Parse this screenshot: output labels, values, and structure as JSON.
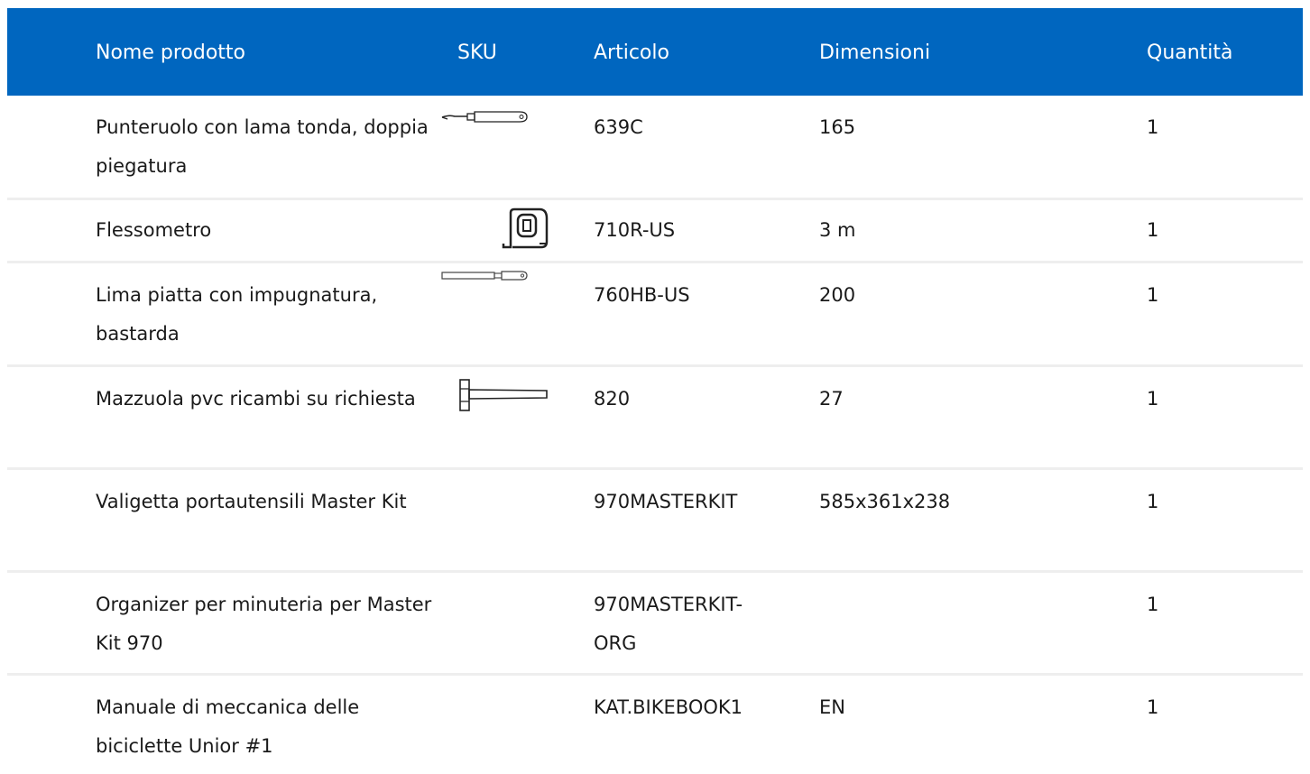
{
  "header": {
    "name": "Nome prodotto",
    "sku": "SKU",
    "article": "Articolo",
    "dimensions": "Dimensioni",
    "quantity": "Quantità"
  },
  "rows": [
    {
      "name": "Punteruolo con lama tonda, doppia piegatura",
      "article": "639C",
      "dimensions": "165",
      "quantity": "1",
      "icon": "awl-icon"
    },
    {
      "name": "Flessometro",
      "article": "710R-US",
      "dimensions": "3 m",
      "quantity": "1",
      "icon": "tape-measure-icon"
    },
    {
      "name": "Lima piatta con impugnatura, bastarda",
      "article": "760HB-US",
      "dimensions": "200",
      "quantity": "1",
      "icon": "file-tool-icon"
    },
    {
      "name": "Mazzuola pvc ricambi su richiesta",
      "article": "820",
      "dimensions": "27",
      "quantity": "1",
      "icon": "mallet-icon"
    },
    {
      "name": "Valigetta portautensili Master Kit",
      "article": "970MASTERKIT",
      "dimensions": "585x361x238",
      "quantity": "1",
      "icon": ""
    },
    {
      "name": "Organizer per minuteria per Master Kit 970",
      "article": "970MASTERKIT-ORG",
      "dimensions": "",
      "quantity": "1",
      "icon": ""
    },
    {
      "name": "Manuale di meccanica delle biciclette Unior #1",
      "article": "KAT.BIKEBOOK1",
      "dimensions": "EN",
      "quantity": "1",
      "icon": ""
    }
  ],
  "colors": {
    "header_bg": "#0066bf",
    "row_divider": "#eeeeee"
  }
}
